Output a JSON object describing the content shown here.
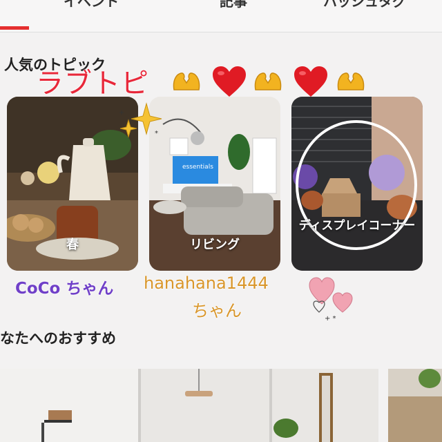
{
  "tabs": [
    {
      "label": "イベント"
    },
    {
      "label": "記事"
    },
    {
      "label": "ハッシュタグ"
    }
  ],
  "popular_topics": {
    "heading": "人気のトピック",
    "overlay_text": "ラブトピ",
    "cards": [
      {
        "label": "春"
      },
      {
        "label": "リビング"
      },
      {
        "label": "ディスプレイコーナー"
      }
    ]
  },
  "tv_screen_text": "essentials",
  "captions": {
    "coco": "CoCo ちゃん",
    "hana_line1": "hanahana1444",
    "hana_line2": "ちゃん"
  },
  "recommend": {
    "heading": "なたへのおすすめ"
  },
  "colors": {
    "accent_red": "#e52f2f",
    "overlay_red": "#e8283a",
    "coco_purple": "#7040c8",
    "hana_gold": "#d9962a"
  },
  "decorations": [
    "heart-hands-icon",
    "red-heart-icon",
    "sparkle-icon",
    "pink-hearts-icon"
  ]
}
